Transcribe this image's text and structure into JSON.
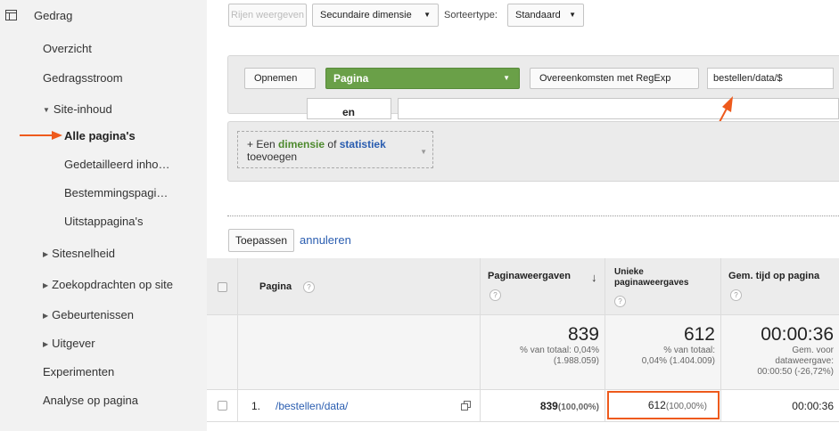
{
  "sidebar": {
    "section": "Gedrag",
    "items": [
      {
        "label": "Overzicht"
      },
      {
        "label": "Gedragsstroom"
      },
      {
        "label": "Site-inhoud"
      },
      {
        "label": "Alle pagina's"
      },
      {
        "label": "Gedetailleerd inho…"
      },
      {
        "label": "Bestemmingspagi…"
      },
      {
        "label": "Uitstappagina's"
      },
      {
        "label": "Sitesnelheid"
      },
      {
        "label": "Zoekopdrachten op site"
      },
      {
        "label": "Gebeurtenissen"
      },
      {
        "label": "Uitgever"
      },
      {
        "label": "Experimenten"
      },
      {
        "label": "Analyse op pagina"
      }
    ]
  },
  "toolbar": {
    "rows_button": "Rijen weergeven",
    "secondary_dimension": "Secundaire dimensie",
    "sort_label": "Sorteertype:",
    "sort_value": "Standaard"
  },
  "filter": {
    "include_value": "Opnemen",
    "dimension_value": "Pagina",
    "match_value": "Overeenkomsten met RegExp",
    "expression_value": "bestellen/data/$",
    "and_label": "en",
    "add_dimension_prefix": "+ Een ",
    "add_dimension_dim": "dimensie",
    "add_dimension_of": " of ",
    "add_dimension_stat": "statistiek",
    "add_dimension_suffix": "toevoegen",
    "apply_button": "Toepassen",
    "cancel_link": "annuleren"
  },
  "table": {
    "headers": {
      "page": "Pagina",
      "pageviews": "Paginaweergaven",
      "unique": "Unieke paginaweergaves",
      "avg_time": "Gem. tijd op pagina"
    },
    "summary": {
      "pageviews": "839",
      "pageviews_pct_1": "% van totaal: 0,04%",
      "pageviews_pct_2": "(1.988.059)",
      "unique": "612",
      "unique_pct_1": "% van totaal:",
      "unique_pct_2": "0,04% (1.404.009)",
      "avg_time": "00:00:36",
      "avg_time_1": "Gem. voor",
      "avg_time_2": "dataweergave:",
      "avg_time_3": "00:00:50 (-26,72%)"
    },
    "rows": [
      {
        "index": "1.",
        "page": "/bestellen/data/",
        "pageviews": "839",
        "pageviews_pct": "(100,00%)",
        "unique": "612",
        "unique_pct": "(100,00%)",
        "avg_time": "00:00:36"
      }
    ]
  },
  "colors": {
    "accent_orange": "#ee5a1c",
    "green_select": "#6aa048",
    "link_blue": "#2a5db0",
    "sidebar_bg": "#f2f2f2"
  }
}
